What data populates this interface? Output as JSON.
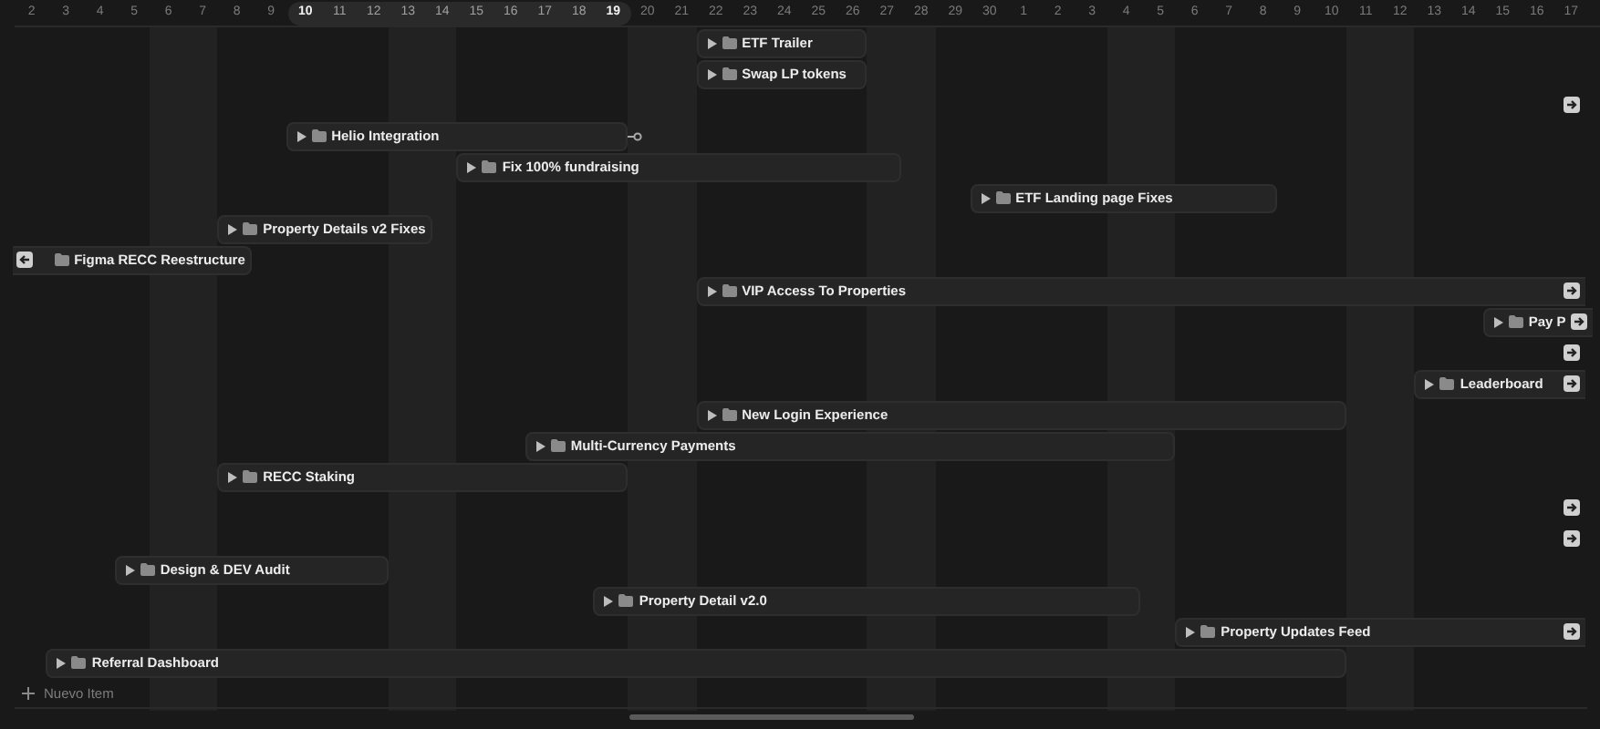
{
  "days": [
    {
      "label": "2",
      "weekend": false,
      "in_range": false,
      "range_edge": false
    },
    {
      "label": "3",
      "weekend": false,
      "in_range": false,
      "range_edge": false
    },
    {
      "label": "4",
      "weekend": false,
      "in_range": false,
      "range_edge": false
    },
    {
      "label": "5",
      "weekend": false,
      "in_range": false,
      "range_edge": false
    },
    {
      "label": "6",
      "weekend": true,
      "in_range": false,
      "range_edge": false
    },
    {
      "label": "7",
      "weekend": true,
      "in_range": false,
      "range_edge": false
    },
    {
      "label": "8",
      "weekend": false,
      "in_range": false,
      "range_edge": false
    },
    {
      "label": "9",
      "weekend": false,
      "in_range": false,
      "range_edge": false
    },
    {
      "label": "10",
      "weekend": false,
      "in_range": true,
      "range_edge": true
    },
    {
      "label": "11",
      "weekend": false,
      "in_range": true,
      "range_edge": false
    },
    {
      "label": "12",
      "weekend": false,
      "in_range": true,
      "range_edge": false
    },
    {
      "label": "13",
      "weekend": true,
      "in_range": true,
      "range_edge": false
    },
    {
      "label": "14",
      "weekend": true,
      "in_range": true,
      "range_edge": false
    },
    {
      "label": "15",
      "weekend": false,
      "in_range": true,
      "range_edge": false
    },
    {
      "label": "16",
      "weekend": false,
      "in_range": true,
      "range_edge": false
    },
    {
      "label": "17",
      "weekend": false,
      "in_range": true,
      "range_edge": false
    },
    {
      "label": "18",
      "weekend": false,
      "in_range": true,
      "range_edge": false
    },
    {
      "label": "19",
      "weekend": false,
      "in_range": true,
      "range_edge": true
    },
    {
      "label": "20",
      "weekend": true,
      "in_range": false,
      "range_edge": false
    },
    {
      "label": "21",
      "weekend": true,
      "in_range": false,
      "range_edge": false
    },
    {
      "label": "22",
      "weekend": false,
      "in_range": false,
      "range_edge": false
    },
    {
      "label": "23",
      "weekend": false,
      "in_range": false,
      "range_edge": false
    },
    {
      "label": "24",
      "weekend": false,
      "in_range": false,
      "range_edge": false
    },
    {
      "label": "25",
      "weekend": false,
      "in_range": false,
      "range_edge": false
    },
    {
      "label": "26",
      "weekend": false,
      "in_range": false,
      "range_edge": false
    },
    {
      "label": "27",
      "weekend": true,
      "in_range": false,
      "range_edge": false
    },
    {
      "label": "28",
      "weekend": true,
      "in_range": false,
      "range_edge": false
    },
    {
      "label": "29",
      "weekend": false,
      "in_range": false,
      "range_edge": false
    },
    {
      "label": "30",
      "weekend": false,
      "in_range": false,
      "range_edge": false
    },
    {
      "label": "1",
      "weekend": false,
      "in_range": false,
      "range_edge": false
    },
    {
      "label": "2",
      "weekend": false,
      "in_range": false,
      "range_edge": false
    },
    {
      "label": "3",
      "weekend": false,
      "in_range": false,
      "range_edge": false
    },
    {
      "label": "4",
      "weekend": true,
      "in_range": false,
      "range_edge": false
    },
    {
      "label": "5",
      "weekend": true,
      "in_range": false,
      "range_edge": false
    },
    {
      "label": "6",
      "weekend": false,
      "in_range": false,
      "range_edge": false
    },
    {
      "label": "7",
      "weekend": false,
      "in_range": false,
      "range_edge": false
    },
    {
      "label": "8",
      "weekend": false,
      "in_range": false,
      "range_edge": false
    },
    {
      "label": "9",
      "weekend": false,
      "in_range": false,
      "range_edge": false
    },
    {
      "label": "10",
      "weekend": false,
      "in_range": false,
      "range_edge": false
    },
    {
      "label": "11",
      "weekend": true,
      "in_range": false,
      "range_edge": false
    },
    {
      "label": "12",
      "weekend": true,
      "in_range": false,
      "range_edge": false
    },
    {
      "label": "13",
      "weekend": false,
      "in_range": false,
      "range_edge": false
    },
    {
      "label": "14",
      "weekend": false,
      "in_range": false,
      "range_edge": false
    },
    {
      "label": "15",
      "weekend": false,
      "in_range": false,
      "range_edge": false
    },
    {
      "label": "16",
      "weekend": false,
      "in_range": false,
      "range_edge": false
    },
    {
      "label": "17",
      "weekend": false,
      "in_range": false,
      "range_edge": false
    }
  ],
  "items": [
    {
      "kind": "bar",
      "title": "ETF Trailer",
      "handle": false,
      "continues_left": false,
      "continues_right": false
    },
    {
      "kind": "bar",
      "title": "Swap LP tokens",
      "handle": false,
      "continues_left": false,
      "continues_right": false
    },
    {
      "kind": "offscreen"
    },
    {
      "kind": "bar",
      "title": "Helio Integration",
      "handle": true,
      "continues_left": false,
      "continues_right": false
    },
    {
      "kind": "bar",
      "title": "Fix 100% fundraising",
      "handle": false,
      "continues_left": false,
      "continues_right": false
    },
    {
      "kind": "bar",
      "title": "ETF Landing page Fixes",
      "handle": false,
      "continues_left": false,
      "continues_right": false
    },
    {
      "kind": "bar",
      "title": "Property Details v2 Fixes",
      "handle": false,
      "continues_left": false,
      "continues_right": false
    },
    {
      "kind": "bar",
      "title": "Figma RECC Reestructure",
      "handle": false,
      "continues_left": true,
      "continues_right": false
    },
    {
      "kind": "bar",
      "title": "VIP Access To Properties",
      "handle": false,
      "continues_left": false,
      "continues_right": true
    },
    {
      "kind": "bar",
      "title": "Pay P",
      "handle": false,
      "continues_left": false,
      "continues_right": true
    },
    {
      "kind": "offscreen"
    },
    {
      "kind": "bar",
      "title": "Leaderboard",
      "handle": false,
      "continues_left": false,
      "continues_right": true
    },
    {
      "kind": "bar",
      "title": "New Login Experience",
      "handle": false,
      "continues_left": false,
      "continues_right": false
    },
    {
      "kind": "bar",
      "title": "Multi-Currency Payments",
      "handle": false,
      "continues_left": false,
      "continues_right": false
    },
    {
      "kind": "bar",
      "title": "RECC Staking",
      "handle": false,
      "continues_left": false,
      "continues_right": false
    },
    {
      "kind": "offscreen"
    },
    {
      "kind": "offscreen"
    },
    {
      "kind": "bar",
      "title": "Design & DEV Audit",
      "handle": false,
      "continues_left": false,
      "continues_right": false
    },
    {
      "kind": "bar",
      "title": "Property Detail v2.0",
      "handle": false,
      "continues_left": false,
      "continues_right": false
    },
    {
      "kind": "bar",
      "title": "Property Updates Feed",
      "handle": false,
      "continues_left": false,
      "continues_right": true
    },
    {
      "kind": "bar",
      "title": "Referral Dashboard",
      "handle": false,
      "continues_left": false,
      "continues_right": false
    }
  ],
  "new_item": {
    "label": "Nuevo Item"
  }
}
